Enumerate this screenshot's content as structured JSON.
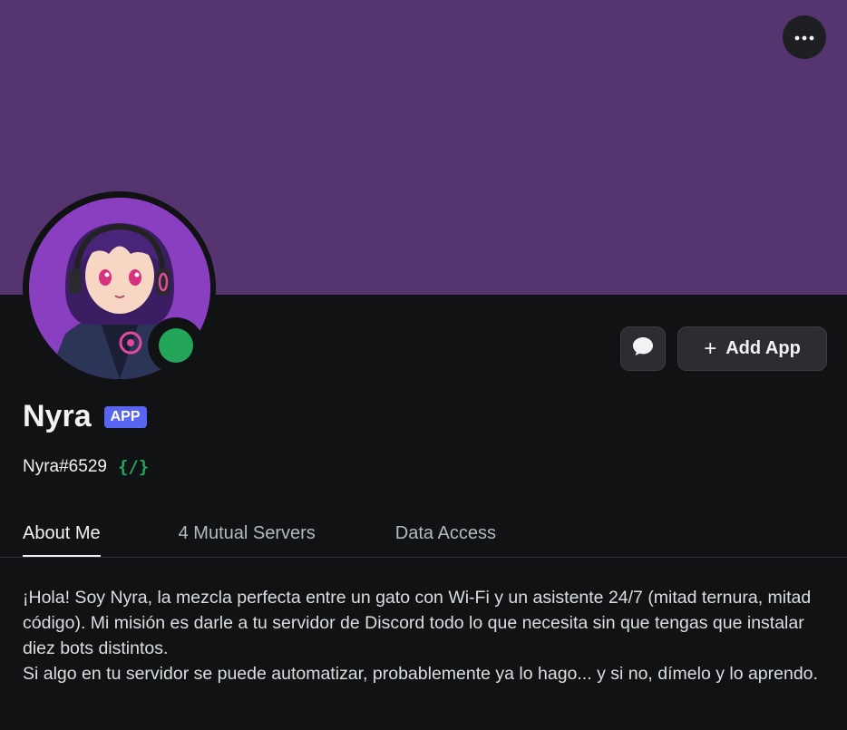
{
  "profile": {
    "display_name": "Nyra",
    "badge": "APP",
    "username": "Nyra#6529",
    "slash_commands_icon": "{/}",
    "status": "online",
    "status_color": "#23a55a",
    "banner_color": "#55346f"
  },
  "actions": {
    "more_label": "⋯",
    "message_icon": "chat-bubble-icon",
    "add_app_label": "Add App",
    "add_app_icon": "+"
  },
  "tabs": [
    {
      "label": "About Me",
      "active": true
    },
    {
      "label": "4 Mutual Servers",
      "active": false
    },
    {
      "label": "Data Access",
      "active": false
    }
  ],
  "about": {
    "paragraph_1": "¡Hola! Soy Nyra, la mezcla perfecta entre un gato con Wi-Fi y un asistente 24/7 (mitad ternura, mitad código). Mi misión es darle a tu servidor de Discord todo lo que necesita sin que tengas que instalar diez bots distintos.",
    "paragraph_2": "Si algo en tu servidor se puede automatizar, probablemente ya lo hago... y si no, dímelo y lo aprendo."
  }
}
